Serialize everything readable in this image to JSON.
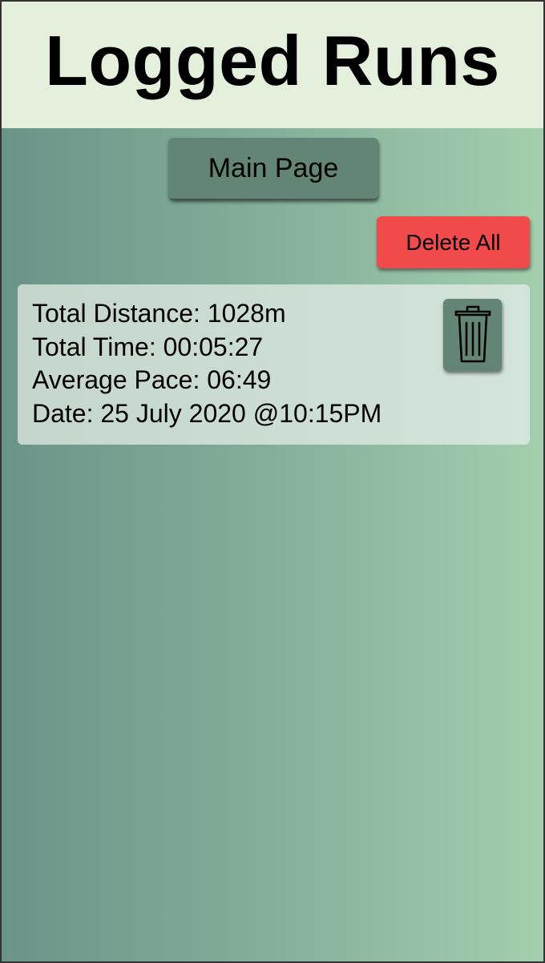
{
  "header": {
    "title": "Logged Runs"
  },
  "nav": {
    "main_page_label": "Main Page"
  },
  "actions": {
    "delete_all_label": "Delete All"
  },
  "runs": [
    {
      "total_distance": "Total Distance: 1028m",
      "total_time": "Total Time: 00:05:27",
      "average_pace": "Average Pace: 06:49",
      "date": "Date: 25 July 2020 @10:15PM",
      "delete_icon": "trash-icon"
    }
  ],
  "colors": {
    "header_bg": "#e4f0dc",
    "gradient_start": "#6a9488",
    "gradient_end": "#a3cfae",
    "button_bg": "#628577",
    "delete_all_bg": "#f04a4b",
    "card_bg": "#d3e4da"
  }
}
